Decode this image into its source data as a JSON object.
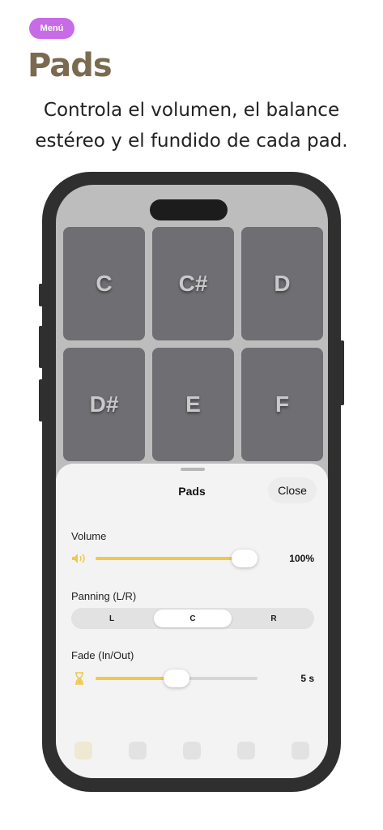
{
  "header": {
    "badge": "Menú",
    "title": "Pads",
    "subtitle_line1": "Controla el volumen, el balance",
    "subtitle_line2": "estéreo y el fundido de cada pad."
  },
  "pads": [
    {
      "label": "C"
    },
    {
      "label": "C#"
    },
    {
      "label": "D"
    },
    {
      "label": "D#"
    },
    {
      "label": "E"
    },
    {
      "label": "F"
    }
  ],
  "sheet": {
    "title": "Pads",
    "close_label": "Close",
    "volume": {
      "label": "Volume",
      "value": 1.0,
      "value_text": "100%"
    },
    "panning": {
      "label": "Panning (L/R)",
      "options": [
        "L",
        "C",
        "R"
      ],
      "selected": "C"
    },
    "fade": {
      "label": "Fade (In/Out)",
      "value": 0.5,
      "value_text": "5 s"
    }
  },
  "colors": {
    "accent": "#f0c84a",
    "badge": "#c86be6",
    "title": "#7a6a4f",
    "pad": "#6e6e73"
  }
}
